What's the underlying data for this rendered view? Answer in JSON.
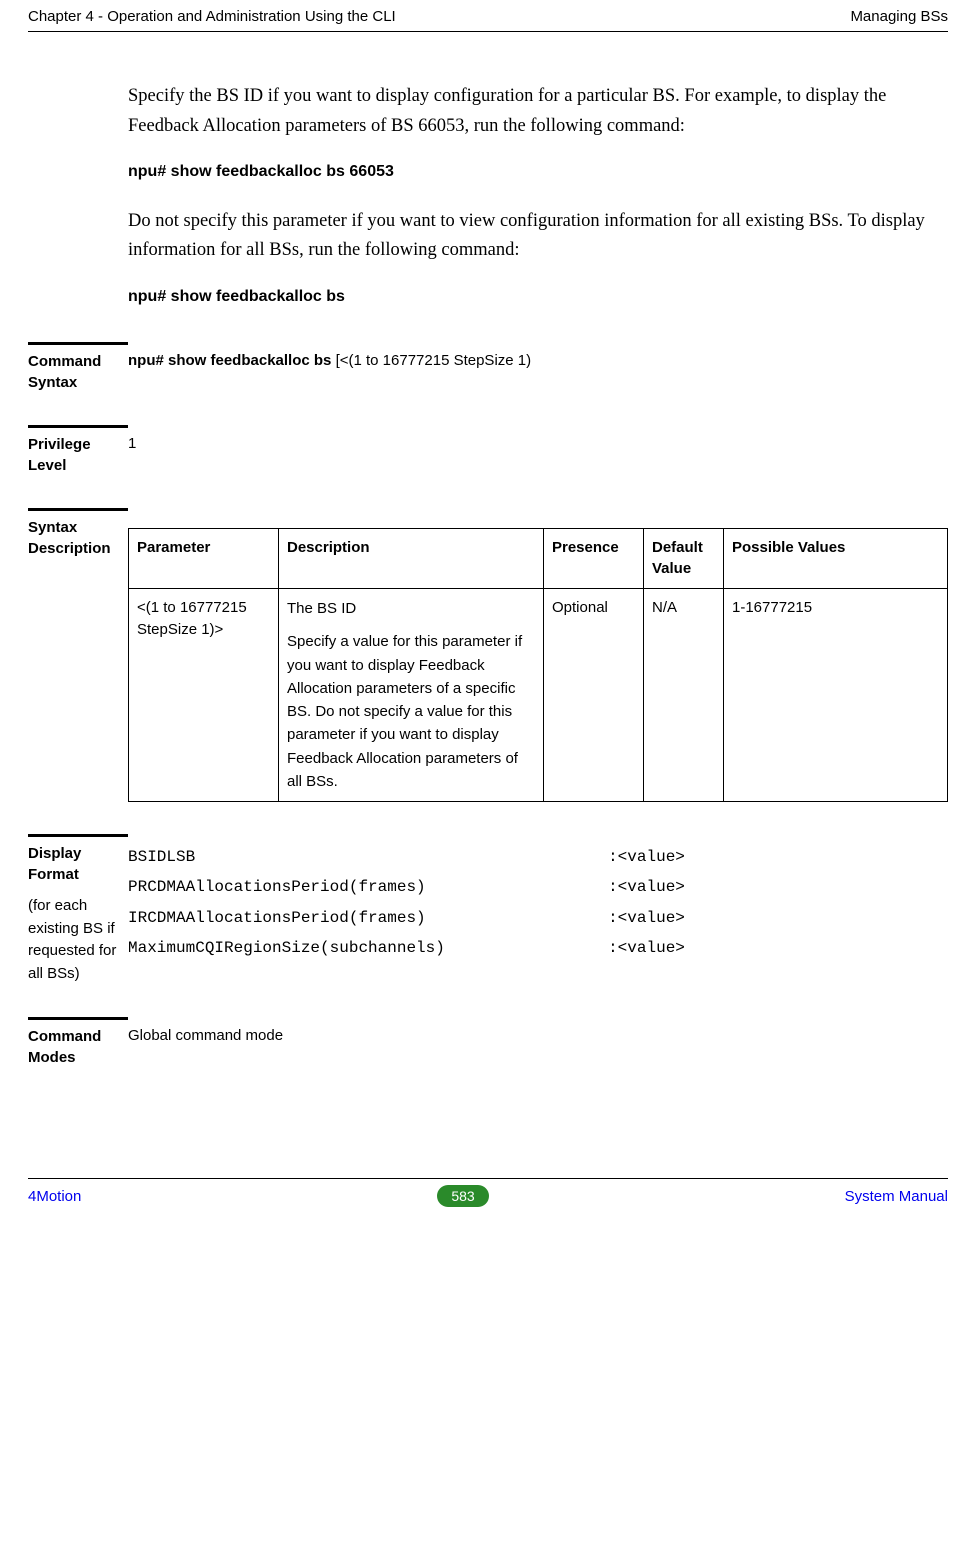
{
  "header": {
    "left": "Chapter 4 - Operation and Administration Using the CLI",
    "right": "Managing BSs"
  },
  "intro": {
    "p1": "Specify the BS ID if you want to display configuration for a particular BS. For example, to display the Feedback Allocation parameters of BS 66053, run the following command:",
    "cmd1": "npu# show feedbackalloc bs 66053",
    "p2": "Do not specify this parameter if you want to view configuration information for all existing BSs. To display information for all BSs, run the following command:",
    "cmd2": "npu# show feedbackalloc bs"
  },
  "command_syntax": {
    "label": "Command Syntax",
    "bold": "npu# show feedbackalloc bs ",
    "rest": "[<(1 to 16777215 StepSize 1)"
  },
  "privilege": {
    "label": "Privilege Level",
    "value": "1"
  },
  "syntax_desc": {
    "label": "Syntax Description",
    "headers": {
      "parameter": "Parameter",
      "description": "Description",
      "presence": "Presence",
      "default": "Default Value",
      "possible": "Possible Values"
    },
    "row": {
      "parameter": "<(1 to 16777215 StepSize 1)>",
      "desc_line1": "The BS ID",
      "desc_rest": "Specify a value for this parameter if you want to display Feedback Allocation parameters of a specific BS. Do not specify a value for this parameter if you want to display Feedback Allocation parameters of all BSs.",
      "presence": "Optional",
      "default": "N/A",
      "possible": "1-16777215"
    }
  },
  "display_format": {
    "label": "Display Format",
    "subnote": "(for each existing BS if requested for all BSs)",
    "lines": "BSIDLSB                                           :<value>\nPRCDMAAllocationsPeriod(frames)                   :<value>\nIRCDMAAllocationsPeriod(frames)                   :<value>\nMaximumCQIRegionSize(subchannels)                 :<value>"
  },
  "command_modes": {
    "label": "Command Modes",
    "value": "Global command mode"
  },
  "footer": {
    "left": "4Motion",
    "page": "583",
    "right": "System Manual"
  },
  "chart_data": {
    "type": "table",
    "title": "Syntax Description",
    "columns": [
      "Parameter",
      "Description",
      "Presence",
      "Default Value",
      "Possible Values"
    ],
    "rows": [
      {
        "Parameter": "<(1 to 16777215 StepSize 1)>",
        "Description": "The BS ID. Specify a value for this parameter if you want to display Feedback Allocation parameters of a specific BS. Do not specify a value for this parameter if you want to display Feedback Allocation parameters of all BSs.",
        "Presence": "Optional",
        "Default Value": "N/A",
        "Possible Values": "1-16777215"
      }
    ]
  }
}
